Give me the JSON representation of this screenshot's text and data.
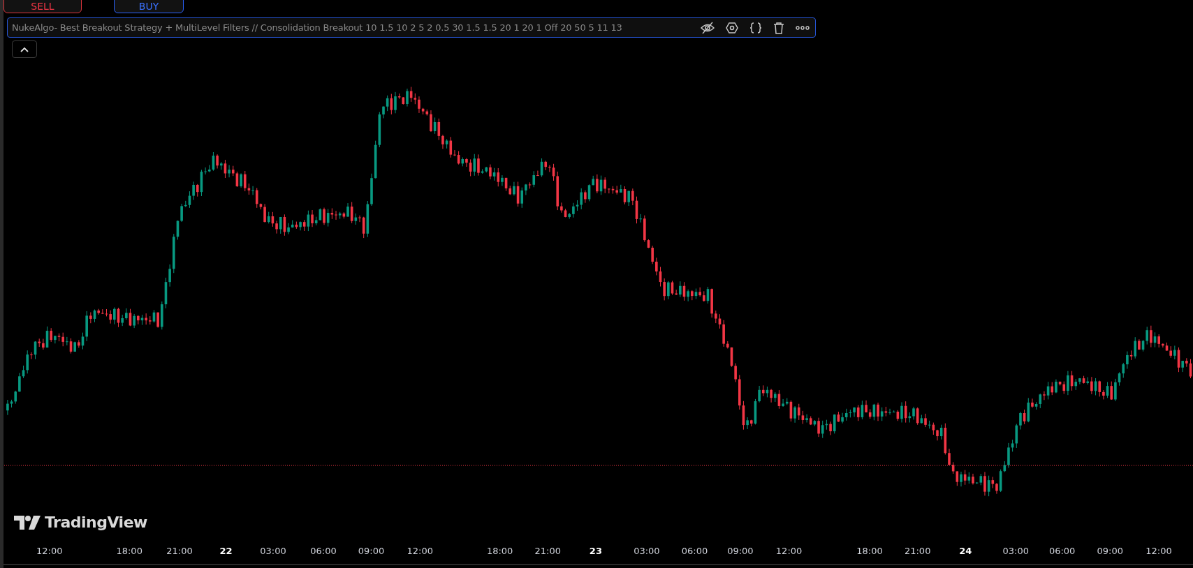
{
  "order_buttons": [
    {
      "kind": "sell",
      "label": "SELL"
    },
    {
      "kind": "buy",
      "label": "BUY"
    }
  ],
  "indicator_legend": {
    "title": "NukeAlgo- Best Breakout Strategy + MultiLevel Filters // Consolidation Breakout 10 1.5 10 2 5 2 0.5 30 1.5 1.5 20 1 20 1 Off 20 50 5 11 13",
    "selected": true
  },
  "logo": {
    "text": "TradingView"
  },
  "time_axis": [
    {
      "label": "12:00",
      "kind": "time"
    },
    {
      "label": "18:00",
      "kind": "time"
    },
    {
      "label": "21:00",
      "kind": "time"
    },
    {
      "label": "22",
      "kind": "day"
    },
    {
      "label": "03:00",
      "kind": "time"
    },
    {
      "label": "06:00",
      "kind": "time"
    },
    {
      "label": "09:00",
      "kind": "time"
    },
    {
      "label": "12:00",
      "kind": "time"
    },
    {
      "label": "18:00",
      "kind": "time"
    },
    {
      "label": "21:00",
      "kind": "time"
    },
    {
      "label": "23",
      "kind": "day"
    },
    {
      "label": "03:00",
      "kind": "time"
    },
    {
      "label": "06:00",
      "kind": "time"
    },
    {
      "label": "09:00",
      "kind": "time"
    },
    {
      "label": "12:00",
      "kind": "time"
    },
    {
      "label": "18:00",
      "kind": "time"
    },
    {
      "label": "21:00",
      "kind": "time"
    },
    {
      "label": "24",
      "kind": "day"
    },
    {
      "label": "03:00",
      "kind": "time"
    },
    {
      "label": "06:00",
      "kind": "time"
    },
    {
      "label": "09:00",
      "kind": "time"
    },
    {
      "label": "12:00",
      "kind": "time"
    }
  ]
}
